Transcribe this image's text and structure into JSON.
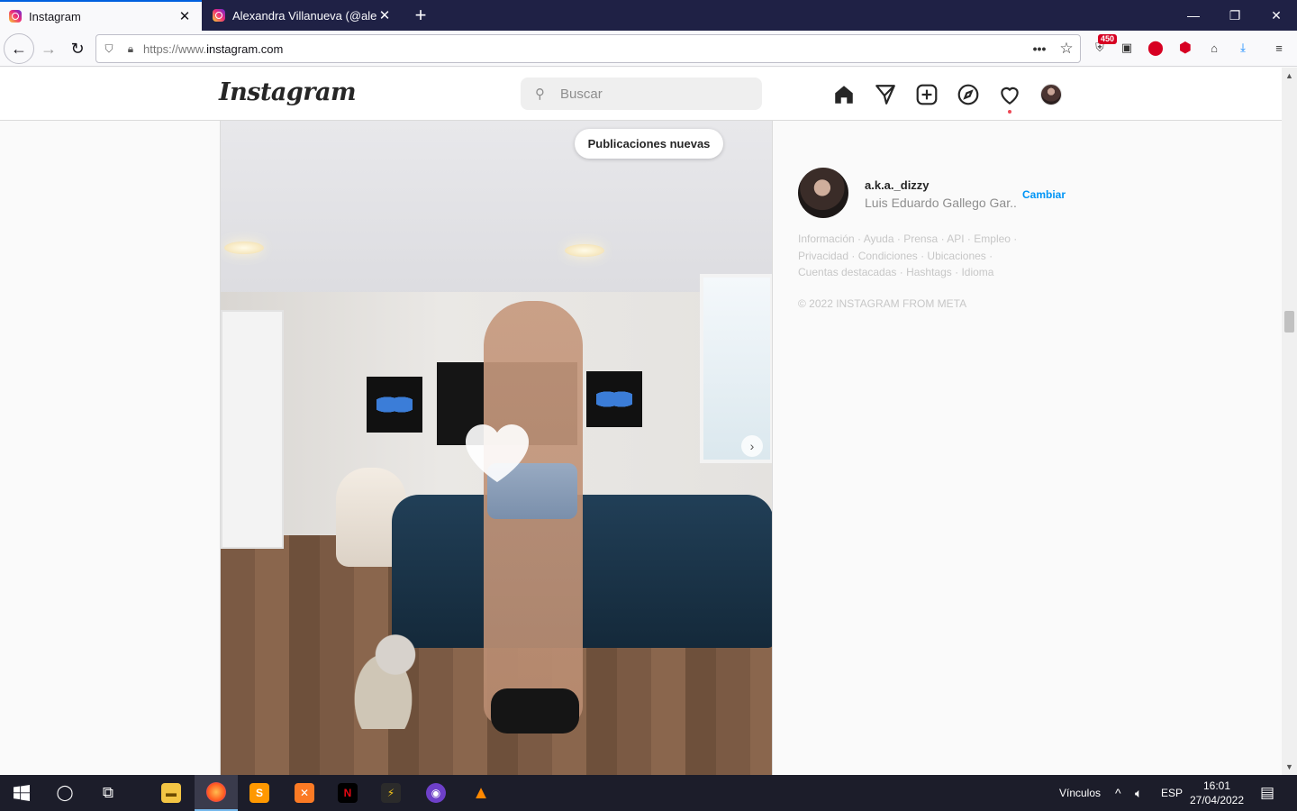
{
  "browser": {
    "tabs": [
      {
        "title": "Instagram",
        "active": true
      },
      {
        "title": "Alexandra Villanueva (@alemiz",
        "active": false
      }
    ],
    "url_scheme": "https://www.",
    "url_host": "instagram.com",
    "extensions": {
      "badge_count": "450"
    }
  },
  "header": {
    "logo_text": "Instagram",
    "search_placeholder": "Buscar"
  },
  "post": {
    "new_posts_label": "Publicaciones nuevas"
  },
  "sidebar": {
    "username": "a.k.a._dizzy",
    "full_name": "Luis Eduardo Gallego Gar...",
    "switch_label": "Cambiar",
    "footer_links": [
      "Información",
      "Ayuda",
      "Prensa",
      "API",
      "Empleo",
      "Privacidad",
      "Condiciones",
      "Ubicaciones",
      "Cuentas destacadas",
      "Hashtags",
      "Idioma"
    ],
    "copyright": "© 2022 INSTAGRAM FROM META"
  },
  "taskbar": {
    "links_label": "Vínculos",
    "language": "ESP",
    "time": "16:01",
    "date": "27/04/2022"
  },
  "colors": {
    "accent_blue": "#0095f6",
    "notification_red": "#ed4956",
    "taskbar_bg": "#1c1d2a",
    "tabstrip_bg": "#1f2145"
  },
  "icons": [
    "home-icon",
    "direct-message-icon",
    "new-post-icon",
    "explore-icon",
    "activity-heart-icon"
  ]
}
